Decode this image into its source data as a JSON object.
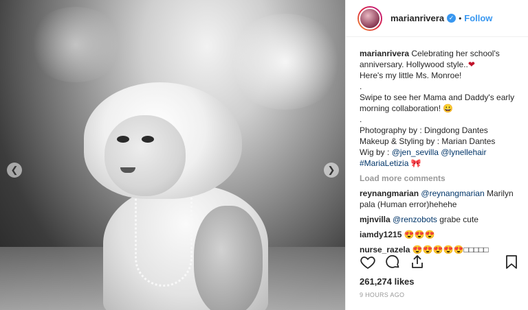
{
  "post": {
    "username": "marianrivera",
    "follow_label": "Follow",
    "dot": "•",
    "caption_lines": [
      "Celebrating her school's anniversary. Hollywood style..",
      "Here's my little Ms. Monroe!",
      ".",
      "Swipe to see her Mama and Daddy's early morning collaboration! 😀",
      ".",
      "Photography by : Dingdong Dantes",
      "Makeup & Styling by : Marian Dantes"
    ],
    "heart": "❤",
    "wig_prefix": "Wig by : ",
    "wig_link1": "@jen_sevilla",
    "wig_link2": "@lynellehair",
    "hashtag": "#MariaLetizia",
    "hashtag_emoji": "🎀",
    "load_more": "Load more comments",
    "comments": [
      {
        "user": "reynangmarian",
        "mention": "@reynangmarian",
        "text": " Marilyn pala (Human error)hehehe"
      },
      {
        "user": "mjnvilla",
        "mention": "@renzobots",
        "text": " grabe cute"
      },
      {
        "user": "iamdy1215",
        "mention": "",
        "text": "😍😍😍"
      },
      {
        "user": "nurse_razela",
        "mention": "",
        "text": "😍😍😍😍😍□□□□□"
      }
    ],
    "likes": "261,274 likes",
    "time": "9 HOURS AGO"
  },
  "nav": {
    "prev": "❮",
    "next": "❯"
  },
  "icons": {
    "verified": "✓"
  },
  "colors": {
    "accent": "#3897f0",
    "heart": "#c0112a",
    "muted": "#999999"
  }
}
